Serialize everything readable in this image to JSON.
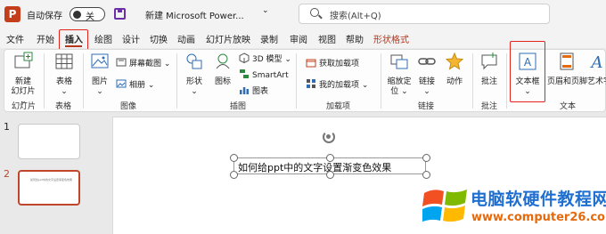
{
  "titlebar": {
    "app_icon_letter": "P",
    "autosave_label": "自动保存",
    "autosave_state": "关",
    "doc_title": "新建 Microsoft Power...",
    "chevron": "⌄",
    "search_placeholder": "搜索(Alt+Q)"
  },
  "tabs": [
    "文件",
    "开始",
    "插入",
    "绘图",
    "设计",
    "切换",
    "动画",
    "幻灯片放映",
    "录制",
    "审阅",
    "视图",
    "帮助",
    "形状格式"
  ],
  "active_tab": "插入",
  "ribbon": {
    "groups": [
      "幻灯片",
      "表格",
      "图像",
      "插图",
      "加载项",
      "链接",
      "批注",
      "文本"
    ],
    "new_slide": [
      "新建",
      "幻灯片 ⌄"
    ],
    "table": "表格",
    "picture": "图片",
    "screenshot": "屏幕截图 ⌄",
    "album": "相册 ⌄",
    "shapes": "形状",
    "icons": "图标",
    "model3d": "3D 模型 ⌄",
    "smartart": "SmartArt",
    "chart": "图表",
    "get_addins": "获取加载项",
    "my_addins": "我的加载项 ⌄",
    "zoom": [
      "缩放定",
      "位 ⌄"
    ],
    "link": "链接",
    "action": "动作",
    "comment": "批注",
    "textbox": [
      "文本框",
      "⌄"
    ],
    "header_footer": "页眉和页脚",
    "wordart": "艺术字"
  },
  "slides": [
    {
      "number": "1"
    },
    {
      "number": "2",
      "preview_text": "如何给ppt中的文字设置渐变色效果"
    }
  ],
  "textbox_content": "如何给ppt中的文字设置渐变色效果",
  "watermark": {
    "title": "电脑软硬件教程网",
    "url": "www.computer26.com"
  },
  "colors": {
    "accent": "#b5361d",
    "highlight_box": "#e2231a",
    "watermark_blue": "#1f6fd1",
    "watermark_orange": "#e46a0d"
  }
}
